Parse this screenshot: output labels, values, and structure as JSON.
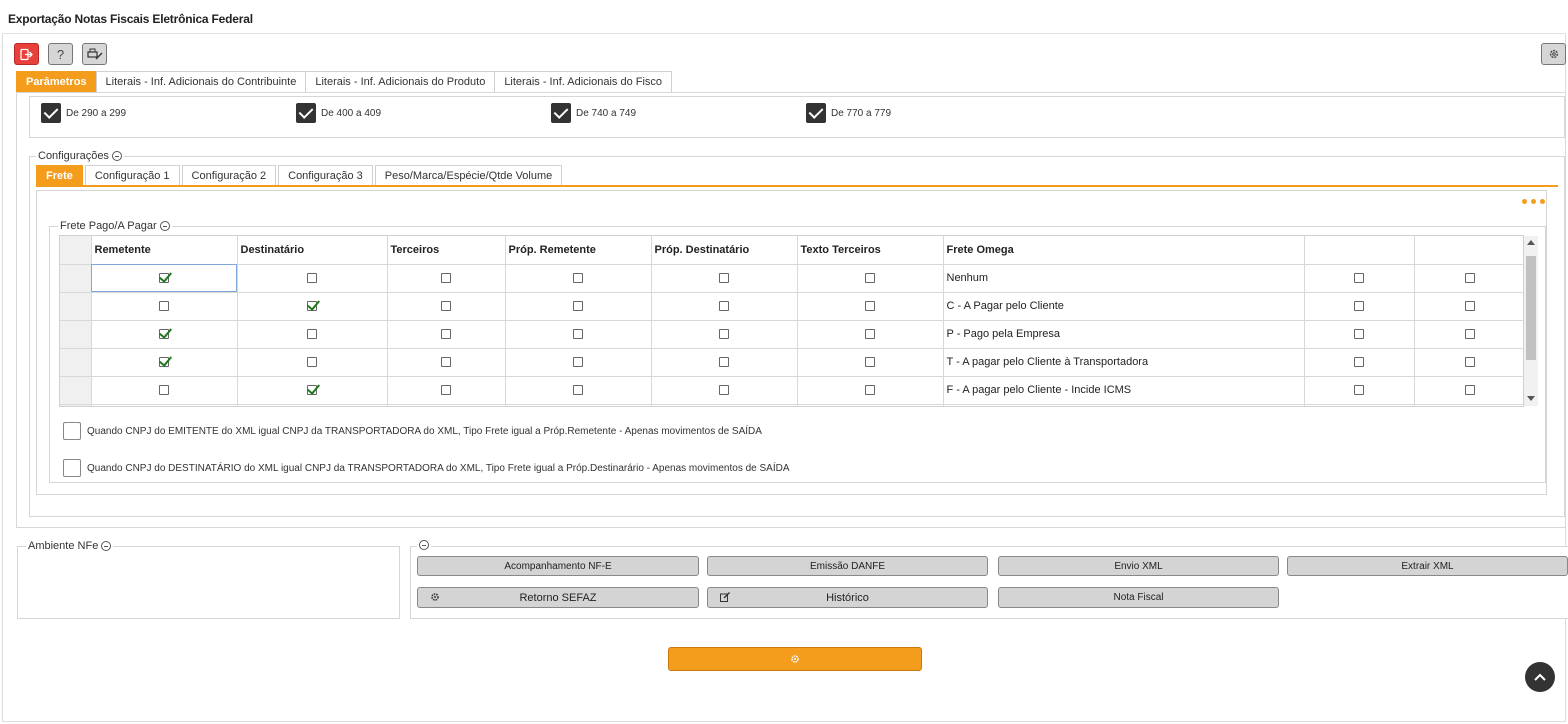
{
  "window": {
    "title": "Exportação Notas Fiscais Eletrônica Federal"
  },
  "toolbar": {
    "exit_icon": "exit-icon",
    "help_label": "?",
    "tool_icon": "printer-settings-icon",
    "settings_icon": "gear-icon"
  },
  "main_tabs": [
    {
      "label": "Parâmetros",
      "active": true
    },
    {
      "label": "Literais - Inf. Adicionais do Contribuinte",
      "active": false
    },
    {
      "label": "Literais - Inf. Adicionais do Produto",
      "active": false
    },
    {
      "label": "Literais - Inf. Adicionais do Fisco",
      "active": false
    }
  ],
  "ranges": [
    {
      "label": "De 290 a 299",
      "checked": true
    },
    {
      "label": "De 400 a 409",
      "checked": true
    },
    {
      "label": "De 740 a 749",
      "checked": true
    },
    {
      "label": "De 770 a 779",
      "checked": true
    }
  ],
  "config": {
    "legend": "Configurações",
    "tabs": [
      {
        "label": "Frete",
        "active": true
      },
      {
        "label": "Configuração 1",
        "active": false
      },
      {
        "label": "Configuração 2",
        "active": false
      },
      {
        "label": "Configuração 3",
        "active": false
      },
      {
        "label": "Peso/Marca/Espécie/Qtde Volume",
        "active": false
      }
    ]
  },
  "frete": {
    "legend": "Frete Pago/A Pagar",
    "columns": [
      "Remetente",
      "Destinatário",
      "Terceiros",
      "Próp. Remetente",
      "Próp. Destinatário",
      "Texto Terceiros",
      "Frete Omega",
      "",
      ""
    ],
    "rows": [
      {
        "remetente": true,
        "destinatario": false,
        "omega": "Nenhum"
      },
      {
        "remetente": false,
        "destinatario": true,
        "omega": "C - A Pagar pelo Cliente"
      },
      {
        "remetente": true,
        "destinatario": false,
        "omega": "P - Pago pela Empresa"
      },
      {
        "remetente": true,
        "destinatario": false,
        "omega": "T - A pagar pelo Cliente à Transportadora"
      },
      {
        "remetente": false,
        "destinatario": true,
        "omega": "F - A pagar pelo Cliente - Incide ICMS"
      }
    ],
    "options": [
      {
        "label": "Quando CNPJ do EMITENTE do XML igual CNPJ da TRANSPORTADORA do XML, Tipo Frete igual a Próp.Remetente - Apenas movimentos de SAÍDA",
        "checked": false
      },
      {
        "label": "Quando CNPJ do DESTINATÁRIO do XML igual CNPJ da TRANSPORTADORA do XML, Tipo Frete igual a Próp.Destinarário - Apenas movimentos de SAÍDA",
        "checked": false
      }
    ]
  },
  "ambiente": {
    "legend": "Ambiente NFe"
  },
  "actions": {
    "acompanhamento": "Acompanhamento NF-E",
    "emissao": "Emissão DANFE",
    "envio": "Envio XML",
    "extrair": "Extrair XML",
    "retorno": "Retorno SEFAZ",
    "historico": "Histórico",
    "nota": "Nota Fiscal"
  }
}
